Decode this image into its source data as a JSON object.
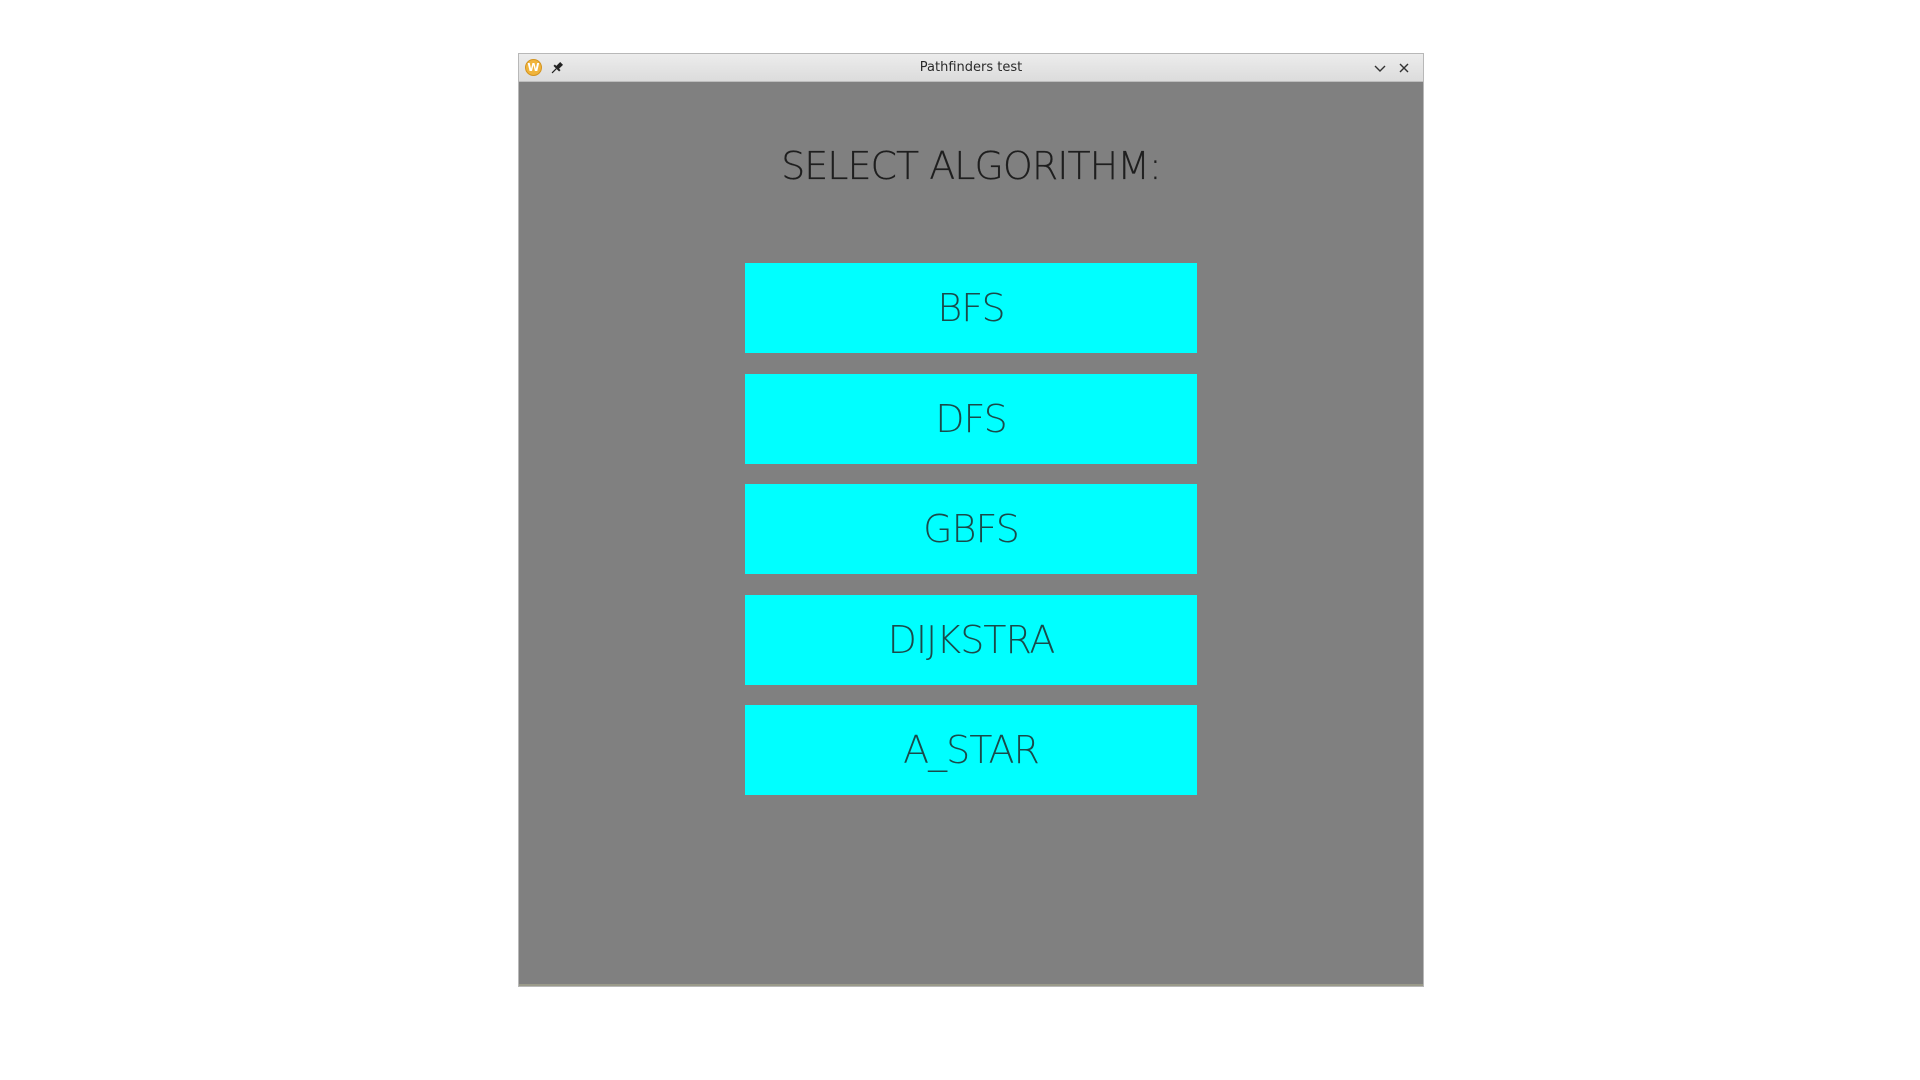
{
  "window": {
    "title": "Pathfinders test",
    "app_icon": "app-logo-icon",
    "app_icon_letter": "W",
    "pin_icon": "pin-icon",
    "minimize_icon": "chevron-down-icon",
    "close_icon": "close-icon"
  },
  "main": {
    "heading": "SELECT ALGORITHM:",
    "algorithms": [
      "BFS",
      "DFS",
      "GBFS",
      "DIJKSTRA",
      "A_STAR"
    ]
  },
  "colors": {
    "background": "#808080",
    "button": "#00ffff",
    "text": "#1e1e1e"
  }
}
